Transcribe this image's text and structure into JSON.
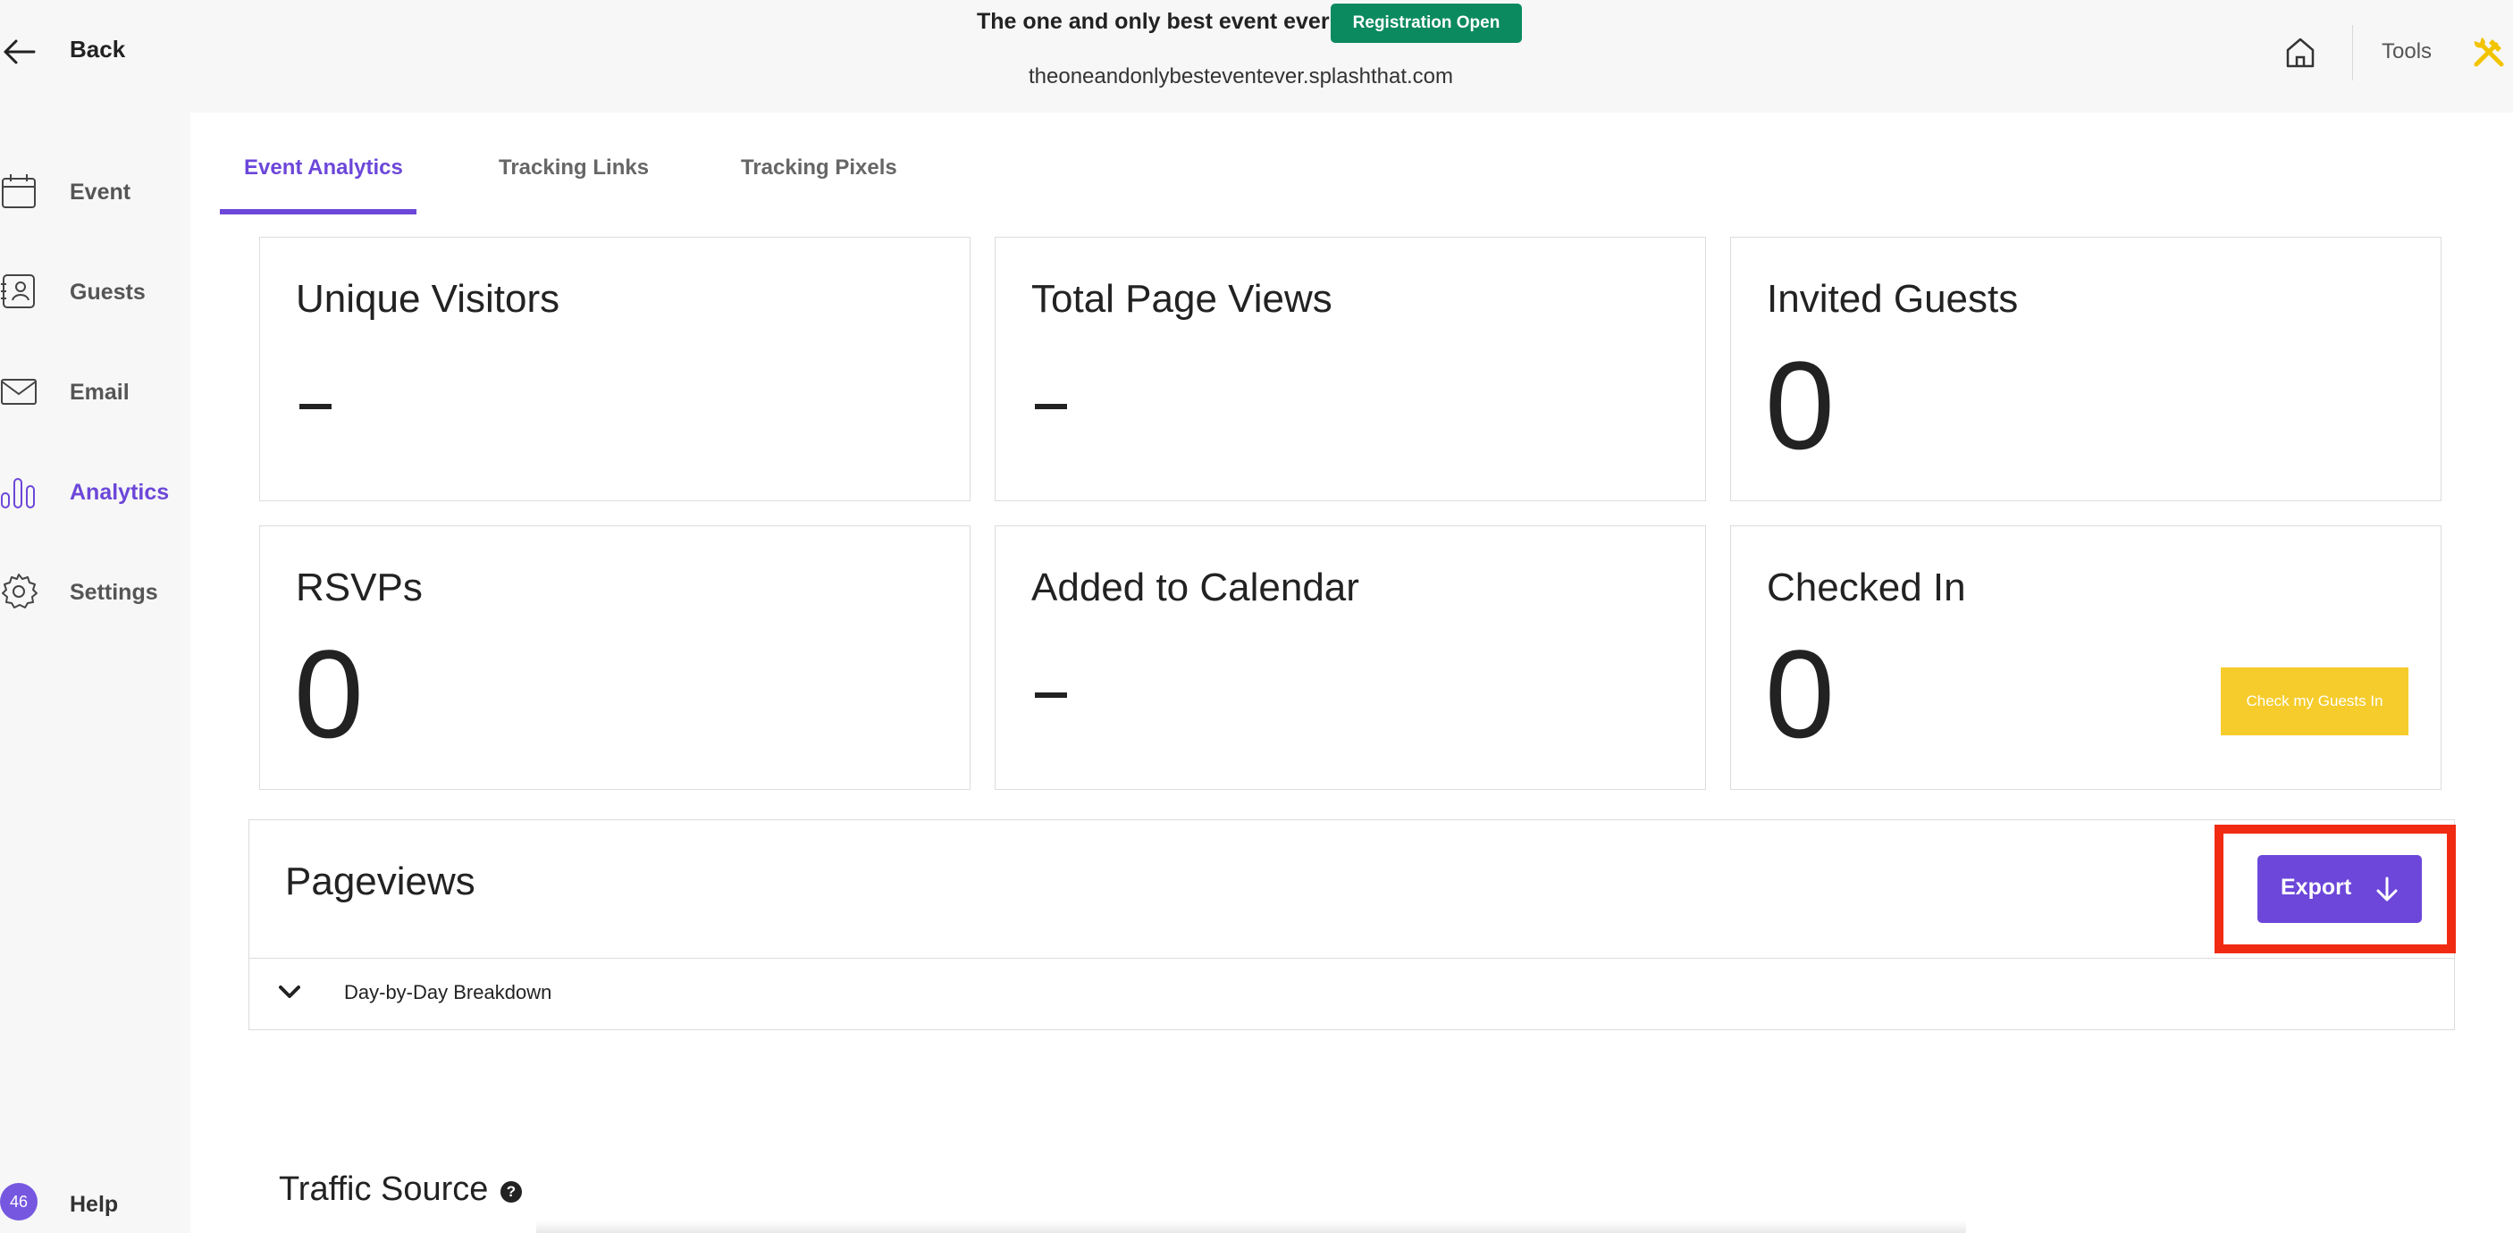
{
  "header": {
    "back_label": "Back",
    "event_title": "The one and only best event ever",
    "status_badge": "Registration Open",
    "event_url": "theoneandonlybesteventever.splashthat.com",
    "tools_label": "Tools"
  },
  "sidebar": {
    "items": [
      {
        "label": "Event",
        "icon": "calendar-icon"
      },
      {
        "label": "Guests",
        "icon": "contact-card-icon"
      },
      {
        "label": "Email",
        "icon": "envelope-icon"
      },
      {
        "label": "Analytics",
        "icon": "bar-chart-icon",
        "active": true
      },
      {
        "label": "Settings",
        "icon": "gear-icon"
      }
    ],
    "help": {
      "badge": "46",
      "label": "Help"
    }
  },
  "tabs": [
    {
      "label": "Event Analytics",
      "active": true
    },
    {
      "label": "Tracking Links"
    },
    {
      "label": "Tracking Pixels"
    }
  ],
  "stats": [
    {
      "title": "Unique Visitors",
      "value": "-"
    },
    {
      "title": "Total Page Views",
      "value": "-"
    },
    {
      "title": "Invited Guests",
      "value": "0"
    },
    {
      "title": "RSVPs",
      "value": "0"
    },
    {
      "title": "Added to Calendar",
      "value": "-"
    },
    {
      "title": "Checked In",
      "value": "0"
    }
  ],
  "checkin_button": "Check my Guests In",
  "pageviews": {
    "title": "Pageviews",
    "export_label": "Export",
    "breakdown_label": "Day-by-Day Breakdown"
  },
  "traffic_source": {
    "title": "Traffic Source",
    "help_icon": "?"
  },
  "colors": {
    "accent": "#6c47d9",
    "badge_green": "#0b8a5f",
    "checkin_yellow": "#f6cc2c",
    "highlight_red": "#f02b12"
  }
}
